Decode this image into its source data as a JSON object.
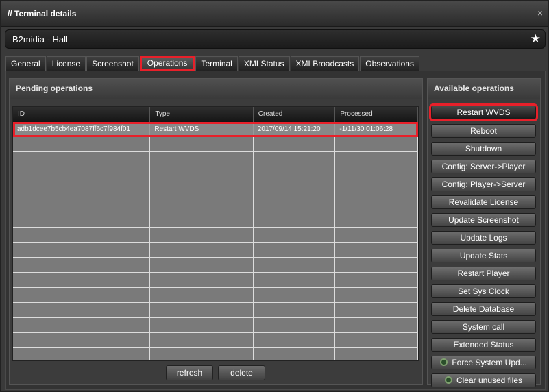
{
  "window": {
    "title": "// Terminal details",
    "close_label": "×"
  },
  "header": {
    "name": "B2midia - Hall",
    "star_label": "★"
  },
  "tabs": [
    "General",
    "License",
    "Screenshot",
    "Operations",
    "Terminal",
    "XMLStatus",
    "XMLBroadcasts",
    "Observations"
  ],
  "active_tab": "Operations",
  "pending": {
    "title": "Pending operations",
    "columns": [
      "ID",
      "Type",
      "Created",
      "Processed"
    ],
    "rows": [
      [
        "adb1dcee7b5cb4ea7087ff6c7f984f01",
        "Restart WVDS",
        "2017/09/14 15:21:20",
        "-1/11/30 01:06:28"
      ]
    ],
    "refresh_label": "refresh",
    "delete_label": "delete"
  },
  "available": {
    "title": "Available operations",
    "buttons": [
      "Restart WVDS",
      "Reboot",
      "Shutdown",
      "Config: Server->Player",
      "Config: Player->Server",
      "Revalidate License",
      "Update Screenshot",
      "Update Logs",
      "Update Stats",
      "Restart Player",
      "Set Sys Clock",
      "Delete Database",
      "System call",
      "Extended Status",
      "Force System Upd...",
      "Clear unused files"
    ]
  }
}
